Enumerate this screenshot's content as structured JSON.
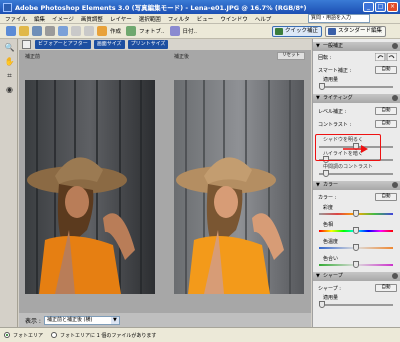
{
  "window": {
    "title": "Adobe Photoshop Elements 3.0 (写真編集モード)  - Lena-e01.JPG @ 16.7% (RGB/8*)"
  },
  "menu": [
    "ファイル",
    "編集",
    "イメージ",
    "画質調整",
    "レイヤー",
    "選択範囲",
    "フィルタ",
    "ビュー",
    "ウインドウ",
    "ヘルプ"
  ],
  "help_search": {
    "value": "質問・用語を入力"
  },
  "toolbar": {
    "create_label": "作成",
    "photo_label": "フォトブ..",
    "date_label": "日付..",
    "quick_fix_label": "クイック補正",
    "standard_edit_label": "スタンダード編集"
  },
  "tabs": [
    "ビフォアーとアフター",
    "画面サイズ",
    "プリントサイズ"
  ],
  "canvas": {
    "before_label": "補正前",
    "after_label": "補正後",
    "reset_label": "リセット"
  },
  "view_select": {
    "label": "表示 :",
    "value": "補正前と補正後 (横)"
  },
  "panel": {
    "general": {
      "title": "一般補正",
      "rotate_label": "回転 :",
      "smart_fix_label": "スマート補正 :",
      "auto_label": "自動",
      "amount_label": "適用量"
    },
    "lighting": {
      "title": "ライティング",
      "levels_label": "レベル補正 :",
      "contrast_label": "コントラスト :",
      "auto_label": "自動",
      "shadow_label": "シャドウを明るく",
      "highlight_label": "ハイライトを暗く",
      "midtone_label": "中間調のコントラスト"
    },
    "color": {
      "title": "カラー",
      "color_label": "カラー :",
      "auto_label": "自動",
      "saturation_label": "彩度",
      "hue_label": "色相",
      "temperature_label": "色温度",
      "tint_label": "色合い"
    },
    "sharpen": {
      "title": "シャープ",
      "sharpen_label": "シャープ :",
      "auto_label": "自動",
      "amount_label": "適用量"
    },
    "values": {
      "smart_fix_amount": 0.0,
      "shadow": 0.5,
      "highlight": 0.06,
      "midtone": 0.06,
      "saturation": 0.5,
      "hue": 0.5,
      "temperature": 0.5,
      "tint": 0.5,
      "sharpen_amount": 0.0
    }
  },
  "status": {
    "option1": "フォトエリア",
    "option2": "フォトエリアに 1 個のファイルがあります"
  },
  "colors": {
    "highlight_red": "#e11111",
    "title_blue": "#1c4fb3",
    "shirt_orange": "#f39a1a"
  }
}
